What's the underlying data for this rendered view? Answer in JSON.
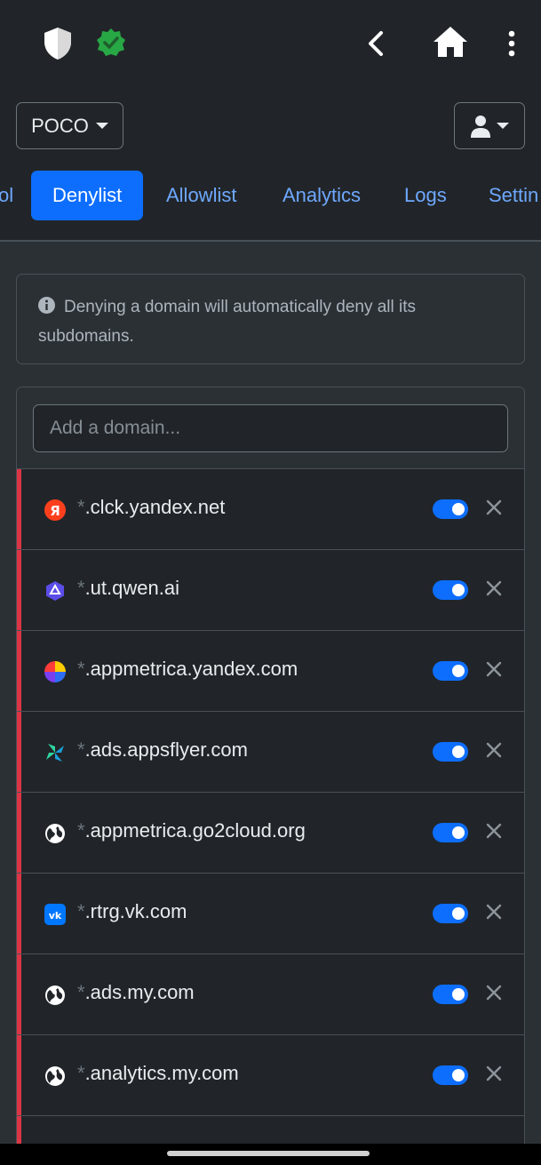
{
  "header": {
    "icons": [
      "shield-icon",
      "verified-badge-icon",
      "back-icon",
      "home-icon",
      "more-vertical-icon"
    ]
  },
  "device_selector": {
    "label": "POCO"
  },
  "tabs": [
    {
      "label": "ol",
      "active": false
    },
    {
      "label": "Denylist",
      "active": true
    },
    {
      "label": "Allowlist",
      "active": false
    },
    {
      "label": "Analytics",
      "active": false
    },
    {
      "label": "Logs",
      "active": false
    },
    {
      "label": "Settin",
      "active": false
    }
  ],
  "alert": {
    "text": "Denying a domain will automatically deny all its subdomains."
  },
  "add_domain": {
    "placeholder": "Add a domain...",
    "value": ""
  },
  "denylist": [
    {
      "wildcard": "*",
      "domain": ".clck.yandex.net",
      "icon": "yandex-icon",
      "enabled": true
    },
    {
      "wildcard": "*",
      "domain": ".ut.qwen.ai",
      "icon": "qwen-icon",
      "enabled": true
    },
    {
      "wildcard": "*",
      "domain": ".appmetrica.yandex.com",
      "icon": "appmetrica-icon",
      "enabled": true
    },
    {
      "wildcard": "*",
      "domain": ".ads.appsflyer.com",
      "icon": "appsflyer-icon",
      "enabled": true
    },
    {
      "wildcard": "*",
      "domain": ".appmetrica.go2cloud.org",
      "icon": "globe-icon",
      "enabled": true
    },
    {
      "wildcard": "*",
      "domain": ".rtrg.vk.com",
      "icon": "vk-icon",
      "enabled": true
    },
    {
      "wildcard": "*",
      "domain": ".ads.my.com",
      "icon": "globe-icon",
      "enabled": true
    },
    {
      "wildcard": "*",
      "domain": ".analytics.my.com",
      "icon": "globe-icon",
      "enabled": true
    }
  ],
  "colors": {
    "background": "#212529",
    "accent": "#0d6efd",
    "deny": "#dc3545",
    "link": "#6ea8fe",
    "verified": "#28a745"
  }
}
